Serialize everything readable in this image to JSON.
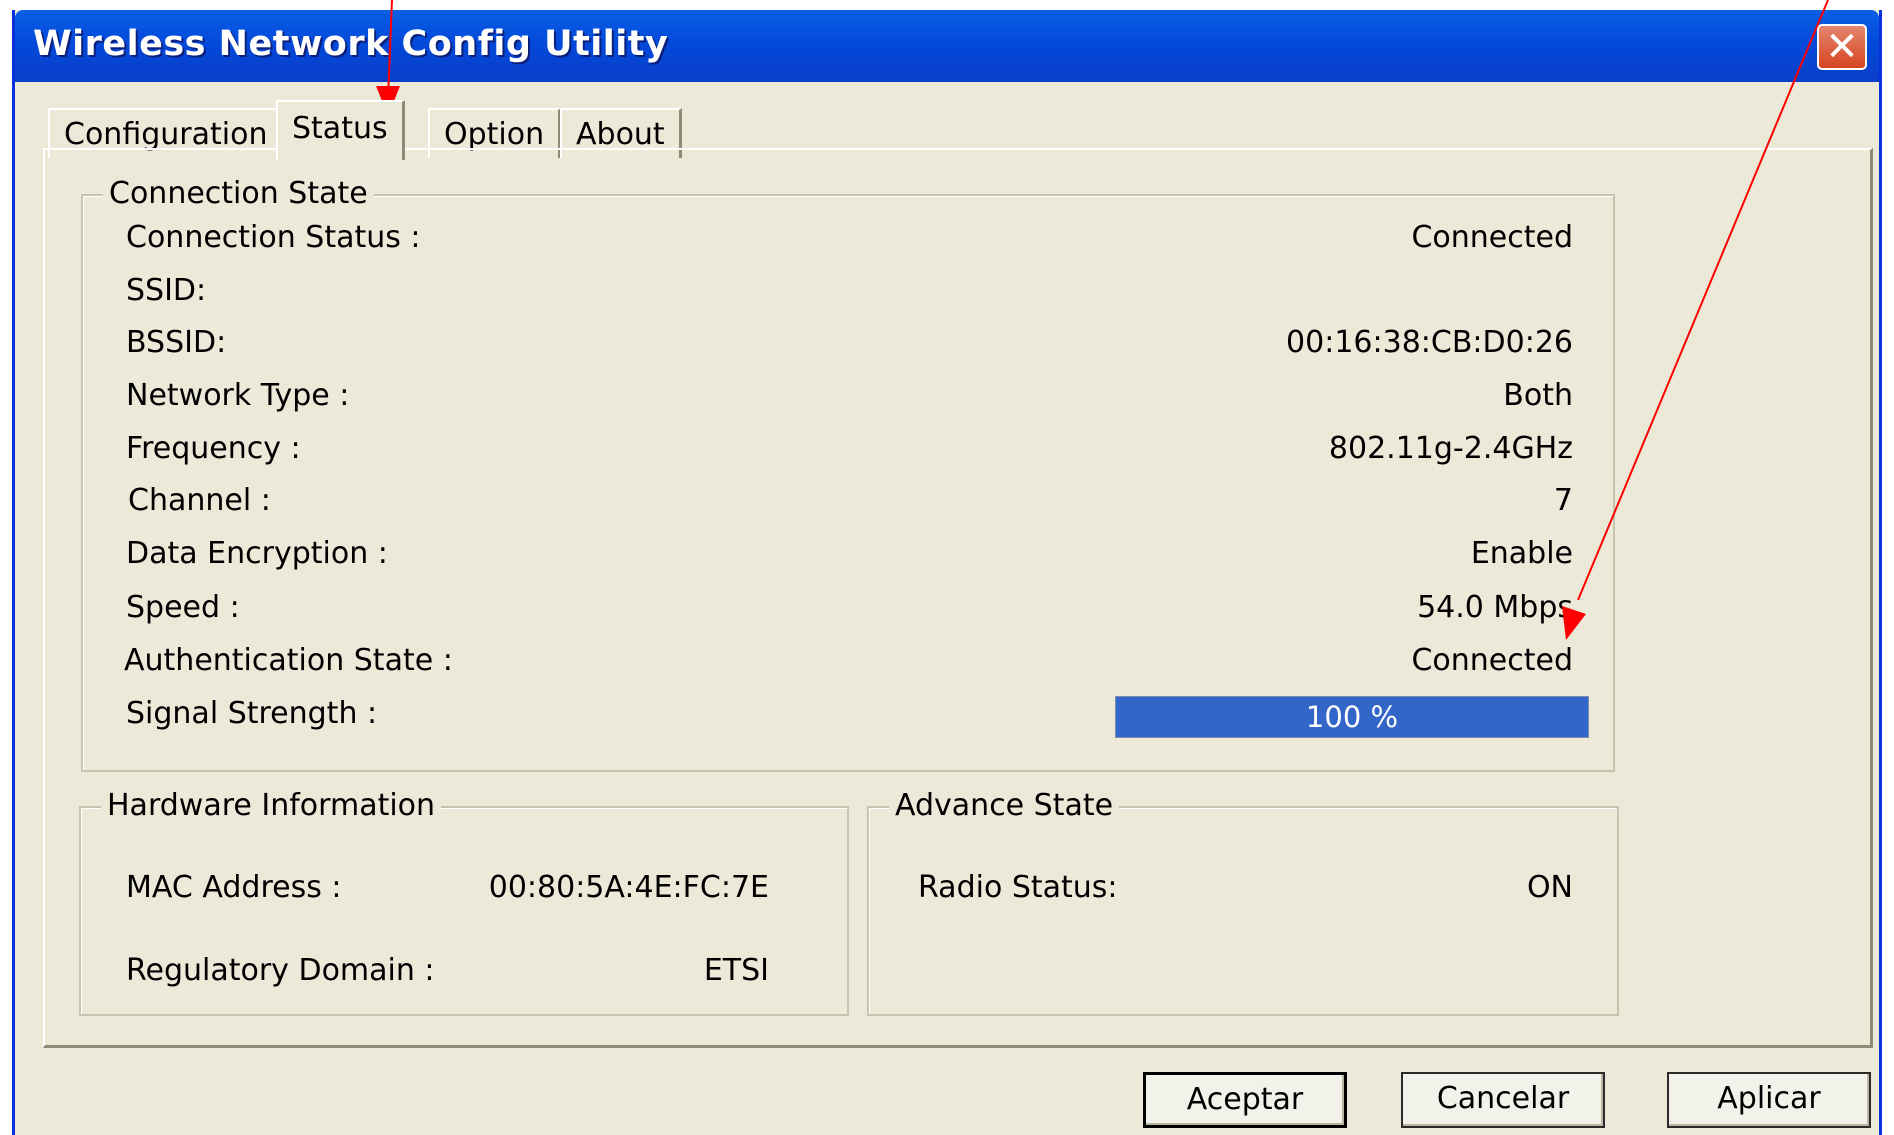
{
  "window": {
    "title": "Wireless Network Config Utility",
    "close_icon": "close-icon"
  },
  "tabs": [
    {
      "label": "Configuration",
      "active": false
    },
    {
      "label": "Status",
      "active": true
    },
    {
      "label": "Option",
      "active": false
    },
    {
      "label": "About",
      "active": false
    }
  ],
  "connection_state": {
    "legend": "Connection State",
    "rows": [
      {
        "label": "Connection Status :",
        "value": "Connected"
      },
      {
        "label": "SSID:",
        "value": ""
      },
      {
        "label": "BSSID:",
        "value": "00:16:38:CB:D0:26"
      },
      {
        "label": "Network Type :",
        "value": "Both"
      },
      {
        "label": "Frequency :",
        "value": "802.11g-2.4GHz"
      },
      {
        "label": "Channel :",
        "value": "7"
      },
      {
        "label": "Data Encryption :",
        "value": "Enable"
      },
      {
        "label": "Speed :",
        "value": "54.0  Mbps"
      },
      {
        "label": "Authentication State :",
        "value": "Connected"
      }
    ],
    "signal": {
      "label": "Signal Strength :",
      "text": "100 %",
      "percent": 100
    }
  },
  "hardware": {
    "legend": "Hardware Information",
    "mac_label": "MAC Address :",
    "mac_value": "00:80:5A:4E:FC:7E",
    "domain_label": "Regulatory Domain :",
    "domain_value": "ETSI"
  },
  "advance": {
    "legend": "Advance State",
    "radio_label": "Radio Status:",
    "radio_value": "ON"
  },
  "buttons": {
    "ok": "Aceptar",
    "cancel": "Cancelar",
    "apply": "Aplicar"
  },
  "colors": {
    "title_bar": "#0348d9",
    "progress": "#3266c8",
    "annotation_arrow": "#ff0000"
  }
}
